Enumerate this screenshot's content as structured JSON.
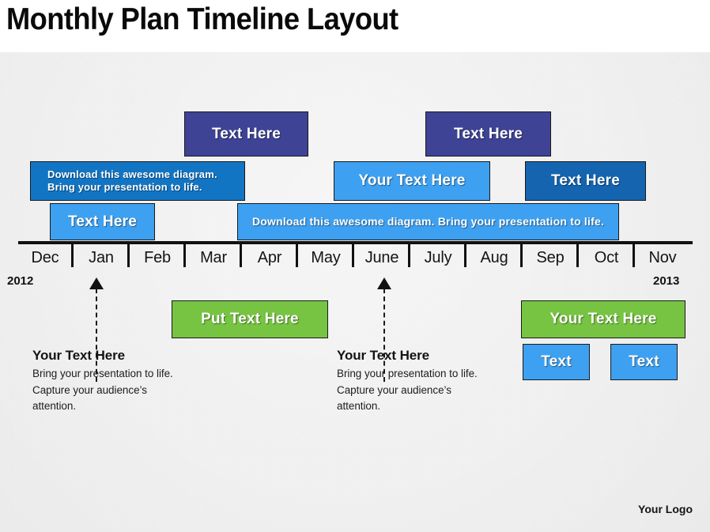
{
  "header": {
    "title": "Monthly Plan Timeline Layout"
  },
  "colors": {
    "dark_blue": "#3E4395",
    "medium_blue": "#1275C4",
    "deep_blue": "#1464B0",
    "light_blue": "#3EA0F0",
    "green": "#76C442",
    "axis": "#111111",
    "background": "#EFEFEF",
    "header_background": "#FFFFFF",
    "text_on_bar": "#FFFFFF"
  },
  "timeline": {
    "months": [
      "Dec",
      "Jan",
      "Feb",
      "Mar",
      "Apr",
      "May",
      "June",
      "July",
      "Aug",
      "Sep",
      "Oct",
      "Nov"
    ],
    "start_year": "2012",
    "end_year": "2013"
  },
  "bars_above": [
    {
      "id": "bar-top-1",
      "label": "Text Here",
      "color": "#3E4395",
      "row": 1,
      "align": "center",
      "font_size": 19
    },
    {
      "id": "bar-top-2",
      "label": "Text Here",
      "color": "#3E4395",
      "row": 1,
      "align": "center",
      "font_size": 19
    },
    {
      "id": "bar-mid-1",
      "label": "Download this awesome diagram.\nBring your presentation to life.",
      "color": "#1275C4",
      "row": 2,
      "align": "left",
      "font_size": 13
    },
    {
      "id": "bar-mid-2",
      "label": "Your Text Here",
      "color": "#3EA0F0",
      "row": 2,
      "align": "center",
      "font_size": 19
    },
    {
      "id": "bar-mid-3",
      "label": "Text Here",
      "color": "#1464B0",
      "row": 2,
      "align": "center",
      "font_size": 19
    },
    {
      "id": "bar-low-1",
      "label": "Text Here",
      "color": "#3EA0F0",
      "row": 3,
      "align": "center",
      "font_size": 19
    },
    {
      "id": "bar-low-2",
      "label": "Download this awesome diagram. Bring your presentation to life.",
      "color": "#3EA0F0",
      "row": 3,
      "align": "center",
      "font_size": 14
    }
  ],
  "bars_below": [
    {
      "id": "bar-below-green-1",
      "label": "Put Text Here",
      "color": "#76C442",
      "font_size": 19
    },
    {
      "id": "bar-below-green-2",
      "label": "Your Text Here",
      "color": "#76C442",
      "font_size": 19
    },
    {
      "id": "bar-below-blue-1",
      "label": "Text",
      "color": "#3EA0F0",
      "font_size": 19
    },
    {
      "id": "bar-below-blue-2",
      "label": "Text",
      "color": "#3EA0F0",
      "font_size": 19
    }
  ],
  "annotations": [
    {
      "id": "annotation-jan",
      "title": "Your Text Here",
      "lines": [
        "Bring your presentation to life.",
        "Capture your audience’s",
        "attention."
      ]
    },
    {
      "id": "annotation-june",
      "title": "Your Text Here",
      "lines": [
        "Bring your presentation to life.",
        "Capture your audience’s",
        "attention."
      ]
    }
  ],
  "footer": {
    "logo": "Your Logo"
  }
}
